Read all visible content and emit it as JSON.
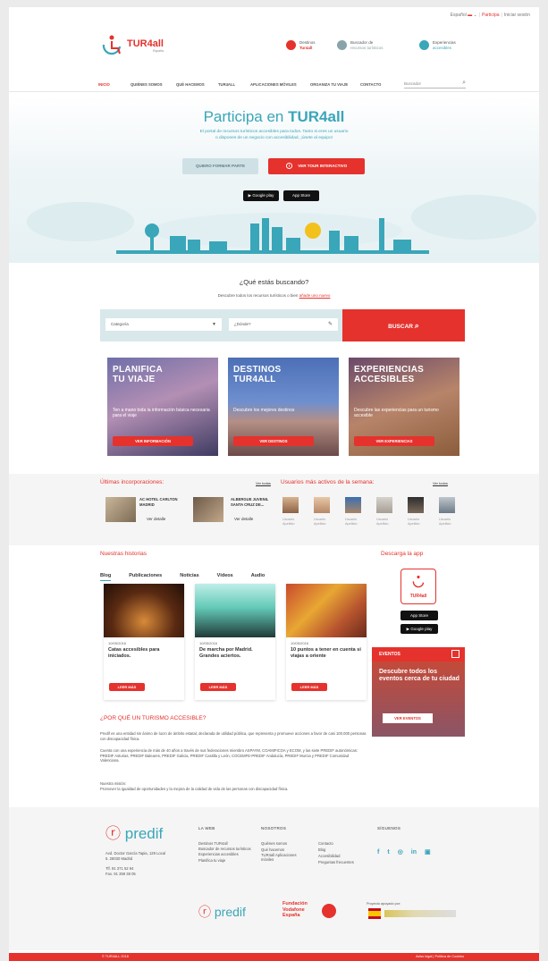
{
  "header": {
    "lang": "Español",
    "participa": "Participa",
    "login": "Iniciar sesión",
    "logo": "TUR4all",
    "logo_sub": "España",
    "quick": [
      {
        "l1": "Destinos",
        "l2": "Tur4all",
        "color": "#e5322d"
      },
      {
        "l1": "Buscador de",
        "l2": "recursos turísticos",
        "color": "#8aa3a8"
      },
      {
        "l1": "Experiencias",
        "l2": "accesibles",
        "color": "#3aa6b9"
      }
    ]
  },
  "nav": {
    "items": [
      "INICIO",
      "QUIÉNES SOMOS",
      "QUÉ HACEMOS",
      "TUR4ALL",
      "APLICACIONES MÓVILES",
      "ORGANIZA TU VIAJE",
      "CONTACTO"
    ],
    "search_placeholder": "Buscador"
  },
  "hero": {
    "title_pre": "Participa en ",
    "title_brand": "TUR4all",
    "subtitle": [
      "El portal de recursos turísticos accesibles para todos. Tanto si eres un usuario",
      "o dispones de un negocio con accesibilidad, ¡únete al equipo!"
    ],
    "btn_join": "QUIERO FORMAR PARTE",
    "btn_tour": "VER TOUR INTERACTIVO",
    "gplay": "Google play",
    "appstore": "App Store"
  },
  "search": {
    "question": "¿Qué estás buscando?",
    "desc": "Descubre todos los recursos turísticos o bien ",
    "desc_link": "añade uno nuevo",
    "category": "Categoría",
    "where": "¿Dónde?",
    "button": "BUSCAR"
  },
  "cards": [
    {
      "title": [
        "PLANIFICA",
        "TU VIAJE"
      ],
      "desc": "Ten a mano toda la información básica necesaria para el viaje",
      "btn": "VER INFORMACIÓN",
      "bg": "linear-gradient(160deg,#6f6fa8,#b38fb4 45%,#3f3b62)"
    },
    {
      "title": [
        "DESTINOS",
        "TUR4ALL"
      ],
      "desc": "Descubre los mejores destinos",
      "btn": "VER DESTINOS",
      "bg": "linear-gradient(#4c6fb6,#6e8fcf 45%,#b58f86 65%,#6a4a48)"
    },
    {
      "title": [
        "EXPERIENCIAS",
        "ACCESIBLES"
      ],
      "desc": "Descubre las experiencias para un turismo accesible",
      "btn": "VER EXPERIENCIAS",
      "bg": "linear-gradient(160deg,#6b4a6a,#b7846a 50%,#8b5d3b)"
    }
  ],
  "latest": {
    "title": "Últimas incorporaciones:",
    "see_all": "Ver todas",
    "items": [
      {
        "name": "AC HOTEL CARLTON MADRID",
        "link": "Ver detalle"
      },
      {
        "name": "ALBERGUE JUVENIL SANTA CRUZ DE...",
        "link": "Ver detalle"
      }
    ]
  },
  "active_users": {
    "title": "Usuarios más activos de la semana:",
    "see_all": "Ver todos",
    "users": [
      {
        "name": "Usuario",
        "surname": "Apellido"
      },
      {
        "name": "Usuario",
        "surname": "Apellido"
      },
      {
        "name": "Usuario",
        "surname": "Apellido"
      },
      {
        "name": "Usuario",
        "surname": "Apellido"
      },
      {
        "name": "Usuario",
        "surname": "Apellido"
      },
      {
        "name": "Usuario",
        "surname": "Apellido"
      }
    ]
  },
  "stories": {
    "title": "Nuestras historias",
    "tabs": [
      "Blog",
      "Publicaciones",
      "Noticias",
      "Vídeos",
      "Audio"
    ],
    "posts": [
      {
        "date": "10/05/2016",
        "title": "Catas accesibles para iniciados.",
        "btn": "LEER MÁS"
      },
      {
        "date": "10/05/2016",
        "title": "De marcha por Madrid. Grandes aciertos.",
        "btn": "LEER MÁS"
      },
      {
        "date": "10/05/2016",
        "title": "10 puntos a tener en cuenta si viajas a oriente",
        "btn": "LEER MÁS"
      }
    ]
  },
  "app": {
    "title": "Descarga la app",
    "logo": "TUR4all",
    "appstore": "App Store",
    "gplay": "Google play"
  },
  "events": {
    "label": "EVENTOS",
    "text": "Descubre todos los eventos cerca de tu ciudad",
    "btn": "VER EVENTOS"
  },
  "why": {
    "title": "¿POR QUÉ UN TURISMO ACCESIBLE?",
    "p1": "Predif es una entidad sin ánimo de lucro de ámbito estatal, declarada de utilidad pública, que representa y promueve acciones a favor de casi 100.000 personas con discapacidad física.",
    "p2": "Cuenta con una experiencia de más de 40 años a través de sus federaciones miembro ASPAYM, COAMIFICOA y ECOM, y las siete PREDIF autonómicas: PREDIF Asturias, PREDIF Baleares, PREDIF Galicia, PREDIF Castilla y León, COCEMFE-PREDIF Andalucía, PREDIF Murcia y PREDIF Comunidad Valenciana.",
    "p3a": "Nuestra misión:",
    "p3": "Promover la igualdad de oportunidades y la mejora de la calidad de vida de las personas con discapacidad física."
  },
  "footer": {
    "logo": "predif",
    "address": [
      "Avd. Doctor García Tapia, 129 Local",
      "5. 28030 Madrid"
    ],
    "phone": [
      "Tlf. 91 371 52 94",
      "Fax. 91 359 38 05"
    ],
    "web_title": "LA WEB",
    "web": [
      "Destinos TUR4all",
      "Buscador de recursos turísticos",
      "Experiencias accesibles",
      "Planifica tu viaje"
    ],
    "us_title": "NOSOTROS",
    "us": [
      "Quiénes somos",
      "Qué hacemos",
      "TUR4all Aplicaciones móviles"
    ],
    "us2": [
      "Contacto",
      "Blog",
      "Accesibilidad",
      "Preguntas frecuentes"
    ],
    "follow_title": "SÍGUENOS",
    "social": [
      "f",
      "t",
      "◎",
      "in",
      "▣"
    ],
    "sponsors": {
      "fund": [
        "Fundación",
        "Vodafone",
        "España"
      ],
      "proyecto": "Proyecto apoyado por:"
    },
    "bottom_left": "© TUR4ALL 2016",
    "bottom_right": [
      "Aviso legal",
      "Política de Cookies"
    ]
  },
  "colors": {
    "accent": "#e5322d",
    "teal": "#3aa6b9"
  }
}
